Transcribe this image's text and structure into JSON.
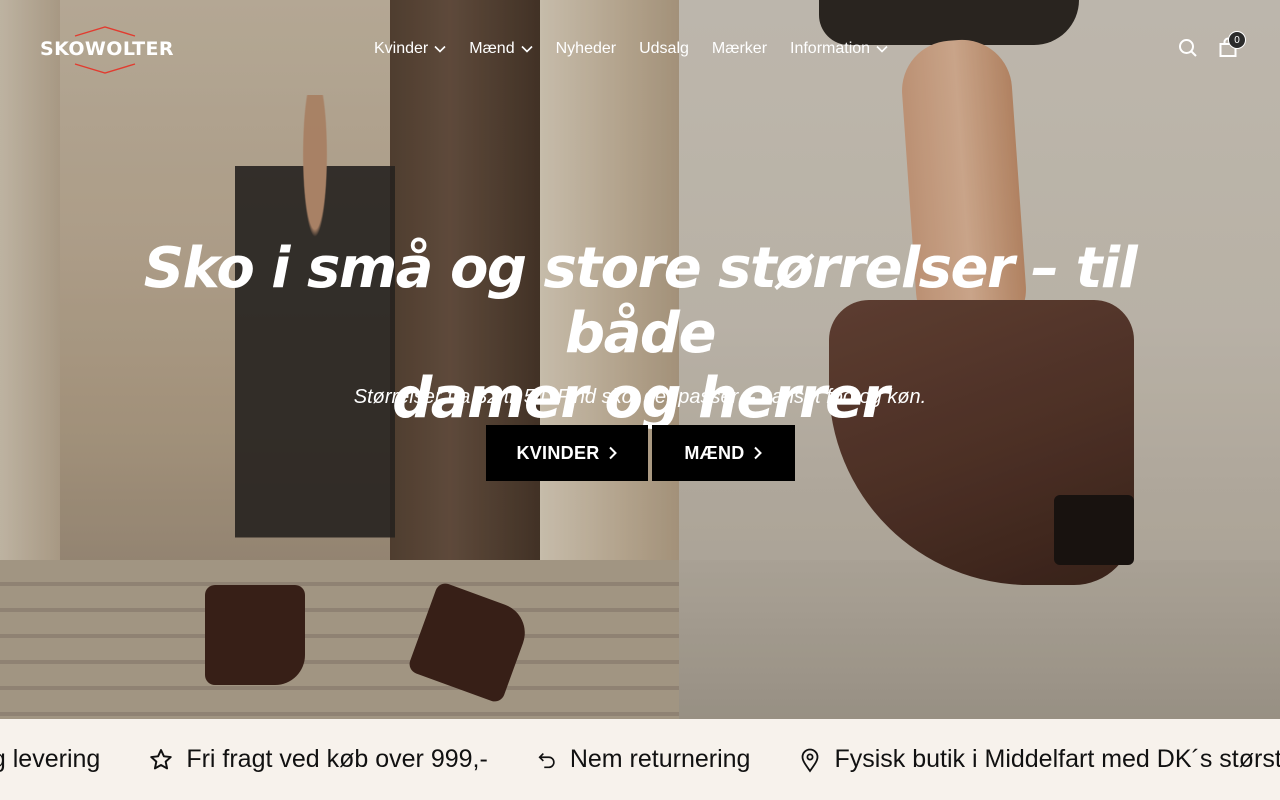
{
  "brand": {
    "logo_text": "SKOWOLTER",
    "accent_color": "#e23b2f"
  },
  "nav": {
    "items": [
      {
        "label": "Kvinder",
        "has_dropdown": true
      },
      {
        "label": "Mænd",
        "has_dropdown": true
      },
      {
        "label": "Nyheder",
        "has_dropdown": false
      },
      {
        "label": "Udsalg",
        "has_dropdown": false
      },
      {
        "label": "Mærker",
        "has_dropdown": false
      },
      {
        "label": "Information",
        "has_dropdown": true
      }
    ]
  },
  "header": {
    "search_icon": "search-icon",
    "cart_icon": "bag-icon",
    "cart_count": "0"
  },
  "hero": {
    "title_line1": "Sko i små og store størrelser – til både",
    "title_line2": "damer og herrer",
    "subtitle": "Størrelser fra 32 til 54. Find sko, der passer – uanset fod og køn.",
    "buttons": [
      {
        "label": "KVINDER"
      },
      {
        "label": "MÆND"
      }
    ]
  },
  "usp": {
    "items": [
      {
        "label": "ag levering",
        "icon": "none"
      },
      {
        "label": "Fri fragt ved køb over 999,-",
        "icon": "star-icon"
      },
      {
        "label": "Nem returnering",
        "icon": "return-icon"
      },
      {
        "label": "Fysisk butik i Middelfart med DK´s største",
        "icon": "location-pin-icon"
      }
    ]
  }
}
